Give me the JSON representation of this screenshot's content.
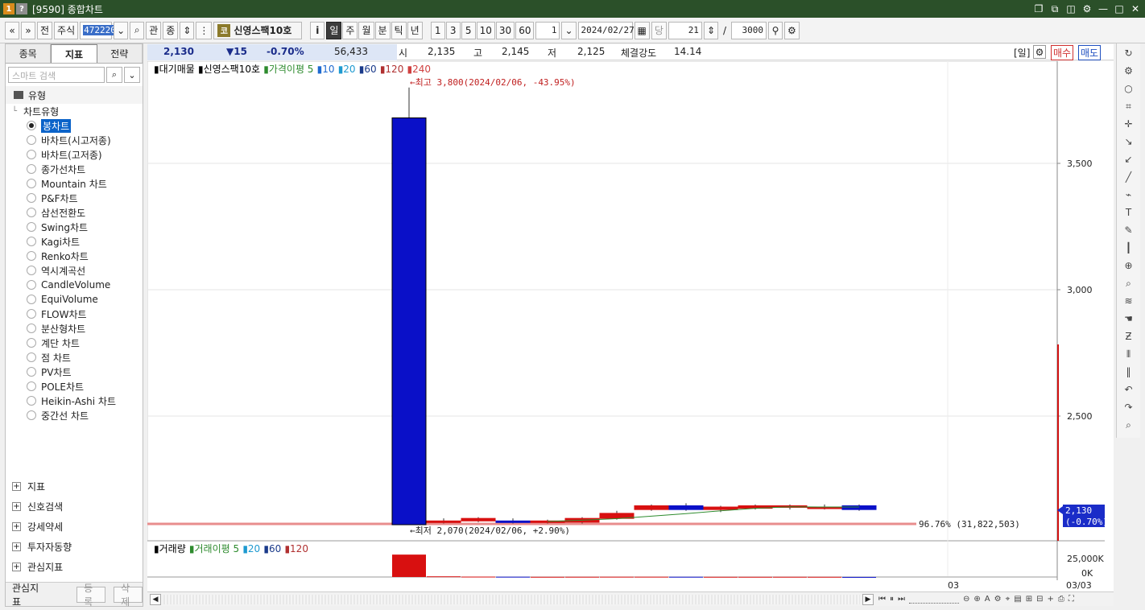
{
  "window": {
    "badge1": "1",
    "badge2": "?",
    "title": "[9590] 종합차트",
    "icons": [
      "restore-icon",
      "copy-icon",
      "screenshot-icon",
      "settings-icon",
      "minimize-icon",
      "maximize-icon",
      "close-icon"
    ]
  },
  "toolbar": {
    "prev_label": "«",
    "down_label": "»",
    "jeon_label": "전",
    "market": "주식",
    "code": "472220",
    "gwan_label": "관",
    "sang_label": "종",
    "stock_badge": "코",
    "stock_name": "신영스팩10호",
    "info_label": "i",
    "periods": [
      "일",
      "주",
      "월",
      "분",
      "틱",
      "년"
    ],
    "active_period": "일",
    "intervals": [
      "1",
      "3",
      "5",
      "10",
      "30",
      "60"
    ],
    "count_value": "1",
    "date": "2024/02/27",
    "dang_label": "당",
    "days_value": "21",
    "slash": "/",
    "total_value": "3000"
  },
  "left_panel": {
    "tabs": [
      "종목",
      "지표",
      "전략"
    ],
    "active_tab": "지표",
    "search_placeholder": "스마트 검색",
    "section_title": "유형",
    "tree_root": "차트유형",
    "chart_types": [
      "봉차트",
      "바차트(시고저종)",
      "바차트(고저종)",
      "종가선차트",
      "Mountain 차트",
      "P&F차트",
      "삼선전환도",
      "Swing차트",
      "Kagi차트",
      "Renko차트",
      "역시계곡선",
      "CandleVolume",
      "EquiVolume",
      "FLOW차트",
      "분산형차트",
      "계단 차트",
      "점 차트",
      "PV차트",
      "POLE차트",
      "Heikin-Ashi 차트",
      "중간선 차트"
    ],
    "selected_type": "봉차트",
    "groups": [
      "지표",
      "신호검색",
      "강세약세",
      "투자자동향",
      "관심지표"
    ],
    "footer_label": "관심지표",
    "register_label": "등록",
    "delete_label": "삭제"
  },
  "infobar": {
    "price": "2,130",
    "change": "▼15",
    "change_pct": "-0.70%",
    "volume": "56,433",
    "open_label": "시",
    "open": "2,135",
    "high_label": "고",
    "high": "2,145",
    "low_label": "저",
    "low": "2,125",
    "strength_label": "체결강도",
    "strength": "14.14",
    "period_tag": "[일]",
    "buy_label": "매수",
    "sell_label": "매도"
  },
  "legend": {
    "items": [
      {
        "text": "대기매물",
        "color": "#000000"
      },
      {
        "text": "신영스팩10호",
        "color": "#000000"
      },
      {
        "text": "가격이평 5",
        "color": "#2e8b2e"
      },
      {
        "text": "10",
        "color": "#1e6ad0"
      },
      {
        "text": "20",
        "color": "#1e9ad0"
      },
      {
        "text": "60",
        "color": "#1a3a8a"
      },
      {
        "text": "120",
        "color": "#b03030"
      },
      {
        "text": "240",
        "color": "#d04040"
      }
    ],
    "volume_items": [
      {
        "text": "거래량",
        "color": "#000000"
      },
      {
        "text": "거래이평 5",
        "color": "#2e8b2e"
      },
      {
        "text": "20",
        "color": "#1e9ad0"
      },
      {
        "text": "60",
        "color": "#1a3a8a"
      },
      {
        "text": "120",
        "color": "#b03030"
      }
    ]
  },
  "annotations": {
    "high": "←최고 3,800(2024/02/06, -43.95%)",
    "low": "←최저 2,070(2024/02/06, +2.90%)",
    "supply": "96.76% (31,822,503)",
    "current_price": "2,130",
    "current_pct": "(-0.70%)",
    "vol_tick_top": "25,000K",
    "vol_tick_bottom": "0K",
    "x_label": "03",
    "x_right_label": "03/03"
  },
  "chart_data": {
    "type": "bar",
    "title": "신영스팩10호",
    "y_ticks": [
      2500,
      3000,
      3500
    ],
    "y_tick_labels": [
      "2,500",
      "3,000",
      "3,500"
    ],
    "ylim": [
      2050,
      3900
    ],
    "candles": [
      {
        "o": 3680,
        "h": 3800,
        "l": 2070,
        "c": 2070
      },
      {
        "o": 2080,
        "h": 2095,
        "l": 2075,
        "c": 2085
      },
      {
        "o": 2085,
        "h": 2100,
        "l": 2080,
        "c": 2095
      },
      {
        "o": 2085,
        "h": 2095,
        "l": 2075,
        "c": 2080
      },
      {
        "o": 2080,
        "h": 2090,
        "l": 2075,
        "c": 2085
      },
      {
        "o": 2080,
        "h": 2100,
        "l": 2075,
        "c": 2095
      },
      {
        "o": 2095,
        "h": 2125,
        "l": 2090,
        "c": 2115
      },
      {
        "o": 2130,
        "h": 2150,
        "l": 2125,
        "c": 2145
      },
      {
        "o": 2145,
        "h": 2155,
        "l": 2125,
        "c": 2130
      },
      {
        "o": 2130,
        "h": 2145,
        "l": 2120,
        "c": 2140
      },
      {
        "o": 2135,
        "h": 2150,
        "l": 2130,
        "c": 2145
      },
      {
        "o": 2140,
        "h": 2150,
        "l": 2130,
        "c": 2145
      },
      {
        "o": 2140,
        "h": 2150,
        "l": 2130,
        "c": 2140
      },
      {
        "o": 2145,
        "h": 2150,
        "l": 2125,
        "c": 2130
      }
    ],
    "volume_max_k": 25000,
    "volumes_k": [
      24000,
      700,
      400,
      300,
      200,
      250,
      300,
      300,
      250,
      200,
      200,
      220,
      200,
      56
    ]
  }
}
